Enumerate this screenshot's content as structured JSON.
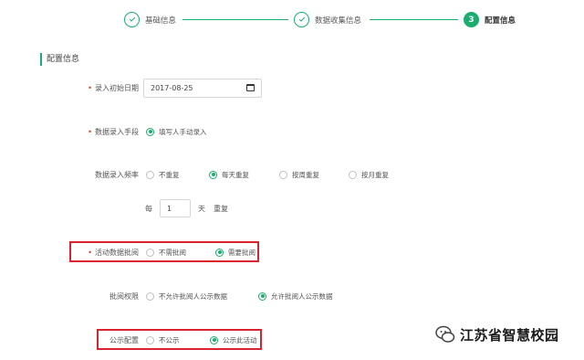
{
  "stepper": {
    "steps": [
      {
        "label": "基础信息",
        "state": "done"
      },
      {
        "label": "数据收集信息",
        "state": "done"
      },
      {
        "label": "配置信息",
        "state": "active",
        "number": "3"
      }
    ]
  },
  "section": {
    "title": "配置信息"
  },
  "form": {
    "start_date": {
      "label": "录入初始日期",
      "required": "•",
      "value": "2017-08-25"
    },
    "entry_method": {
      "label": "数据录入手段",
      "required": "•",
      "options": [
        "填写人手动录入"
      ],
      "selected": "填写人手动录入"
    },
    "entry_frequency": {
      "label": "数据录入频率",
      "options": [
        "不重复",
        "每天重复",
        "按周重复",
        "按月重复"
      ],
      "selected": "每天重复"
    },
    "repeat_every": {
      "prefix": "每",
      "value": "1",
      "unit": "天",
      "suffix": "重复"
    },
    "activity_review": {
      "label": "活动数据批阅",
      "required": "•",
      "options": [
        "不需批阅",
        "需要批阅"
      ],
      "selected": "需要批阅"
    },
    "review_permission": {
      "label": "批阅权限",
      "options": [
        "不允许批阅人公示数据",
        "允许批阅人公示数据"
      ],
      "selected": "允许批阅人公示数据"
    },
    "publicity": {
      "label": "公示配置",
      "options": [
        "不公示",
        "公示此活动"
      ],
      "selected": "公示此活动"
    }
  },
  "watermark": {
    "text": "江苏省智慧校园"
  },
  "colors": {
    "accent": "#1aad6d",
    "required": "#e0342b",
    "highlight": "#d9232e"
  }
}
